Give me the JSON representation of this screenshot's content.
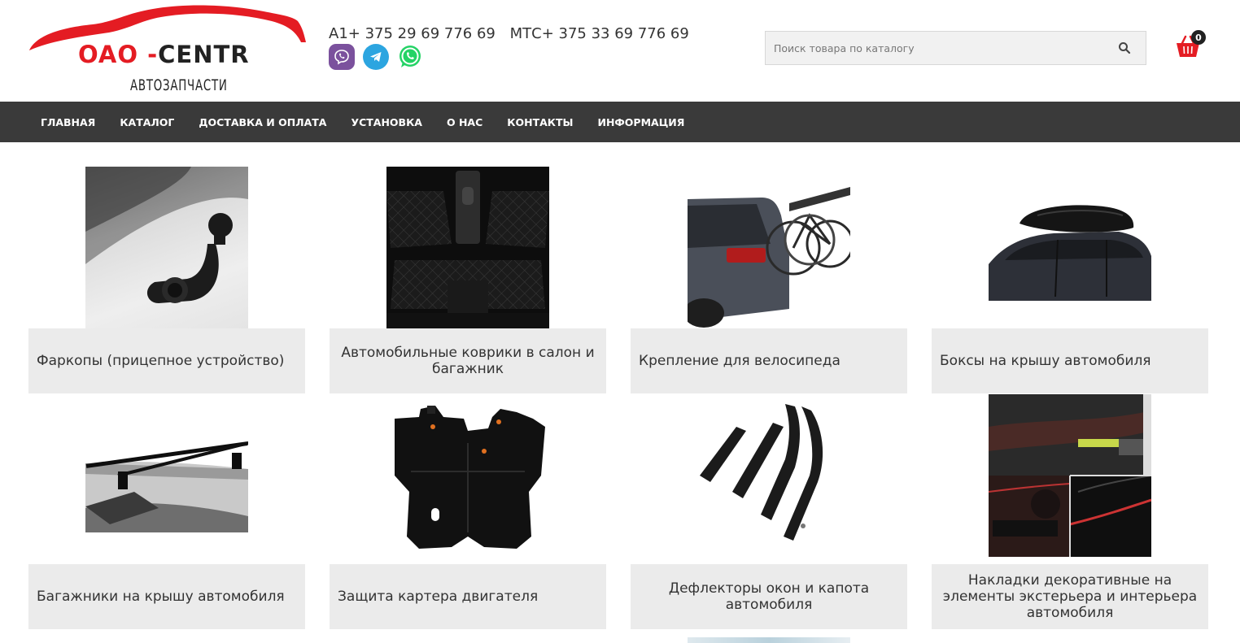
{
  "header": {
    "logo": {
      "brand_part1": "OAO -",
      "brand_part2": "CENTR",
      "subtitle": "АВТОЗАПЧАСТИ",
      "accent_color": "#e41c23"
    },
    "phones": {
      "a1": "A1+ 375 29 69 776 69",
      "mts": "МТС+ 375 33 69 776 69"
    },
    "messengers": [
      "viber-icon",
      "telegram-icon",
      "whatsapp-icon"
    ],
    "search": {
      "placeholder": "Поиск товара по каталогу",
      "value": ""
    },
    "cart": {
      "count": "0",
      "icon": "basket-icon",
      "color": "#e41c23"
    }
  },
  "nav": {
    "background": "#3a3a3a",
    "items": [
      "ГЛАВНАЯ",
      "КАТАЛОГ",
      "ДОСТАВКА И ОПЛАТА",
      "УСТАНОВКА",
      "О НАС",
      "КОНТАКТЫ",
      "ИНФОРМАЦИЯ"
    ]
  },
  "categories": [
    {
      "label": "Фаркопы (прицепное устройство)"
    },
    {
      "label": "Автомобильные коврики в салон и багажник"
    },
    {
      "label": "Крепление для велосипеда"
    },
    {
      "label": "Боксы на крышу автомобиля"
    },
    {
      "label": "Багажники на крышу автомобиля"
    },
    {
      "label": "Защита картера двигателя"
    },
    {
      "label": "Дефлекторы окон и капота автомобиля"
    },
    {
      "label": "Накладки декоративные на элементы экстерьера и интерьера автомобиля"
    }
  ]
}
